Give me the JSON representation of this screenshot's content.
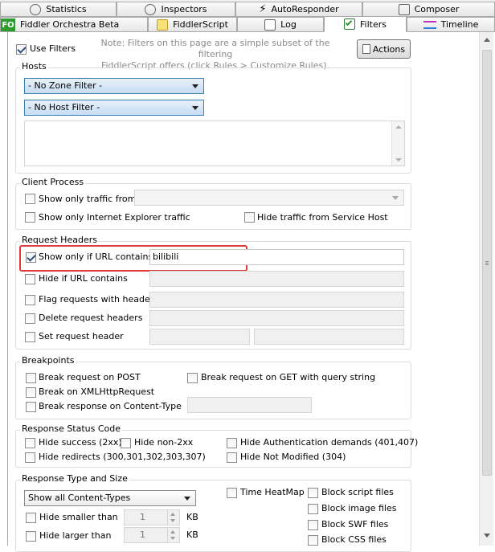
{
  "tabs": {
    "row1": [
      {
        "label": "Statistics",
        "icon": "stopwatch-icon"
      },
      {
        "label": "Inspectors",
        "icon": "inspect-icon"
      },
      {
        "label": "AutoResponder",
        "icon": "lightning-icon"
      },
      {
        "label": "Composer",
        "icon": "compose-icon"
      }
    ],
    "row2": [
      {
        "label": "Fiddler Orchestra Beta",
        "icon": "fo-icon",
        "badge": "FO"
      },
      {
        "label": "FiddlerScript",
        "icon": "script-icon"
      },
      {
        "label": "Log",
        "icon": "log-icon"
      },
      {
        "label": "Filters",
        "icon": "check-icon",
        "active": true
      },
      {
        "label": "Timeline",
        "icon": "timeline-icon"
      }
    ]
  },
  "toolbar": {
    "use_filters_label": "Use Filters",
    "use_filters_checked": true,
    "note_line1": "Note: Filters on this page are a simple subset of the filtering",
    "note_line2": "FiddlerScript offers (click Rules > Customize Rules).",
    "actions_label": "Actions"
  },
  "hosts": {
    "title": "Hosts",
    "zone_filter": "- No Zone Filter -",
    "host_filter": "- No Host Filter -"
  },
  "client_process": {
    "title": "Client Process",
    "show_only_traffic_from": "Show only traffic from",
    "show_only_ie": "Show only Internet Explorer traffic",
    "hide_service_host": "Hide traffic from Service Host"
  },
  "request_headers": {
    "title": "Request Headers",
    "show_only_url": "Show only if URL contains",
    "show_only_url_value": "bilibili",
    "hide_if_url": "Hide if URL contains",
    "flag_requests": "Flag requests with headers",
    "delete_request": "Delete request headers",
    "set_request": "Set request header"
  },
  "breakpoints": {
    "title": "Breakpoints",
    "break_post": "Break request on POST",
    "break_get": "Break request on GET with query string",
    "break_xhr": "Break on XMLHttpRequest",
    "break_content_type": "Break response on Content-Type"
  },
  "response_status": {
    "title": "Response Status Code",
    "hide_success": "Hide success (2xx)",
    "hide_non2xx": "Hide non-2xx",
    "hide_auth": "Hide Authentication demands (401,407)",
    "hide_redirects": "Hide redirects (300,301,302,303,307)",
    "hide_not_modified": "Hide Not Modified (304)"
  },
  "response_type": {
    "title": "Response Type and Size",
    "content_types": "Show all Content-Types",
    "time_heatmap": "Time HeatMap",
    "block_script": "Block script files",
    "block_image": "Block image files",
    "block_swf": "Block SWF files",
    "block_css": "Block CSS files",
    "hide_smaller": "Hide smaller than",
    "hide_larger": "Hide larger than",
    "smaller_value": "1",
    "larger_value": "1",
    "unit": "KB"
  },
  "colors": {
    "highlight": "#e23b3b",
    "accent": "#3c7fb1",
    "fo_badge": "#2e9b2e"
  }
}
